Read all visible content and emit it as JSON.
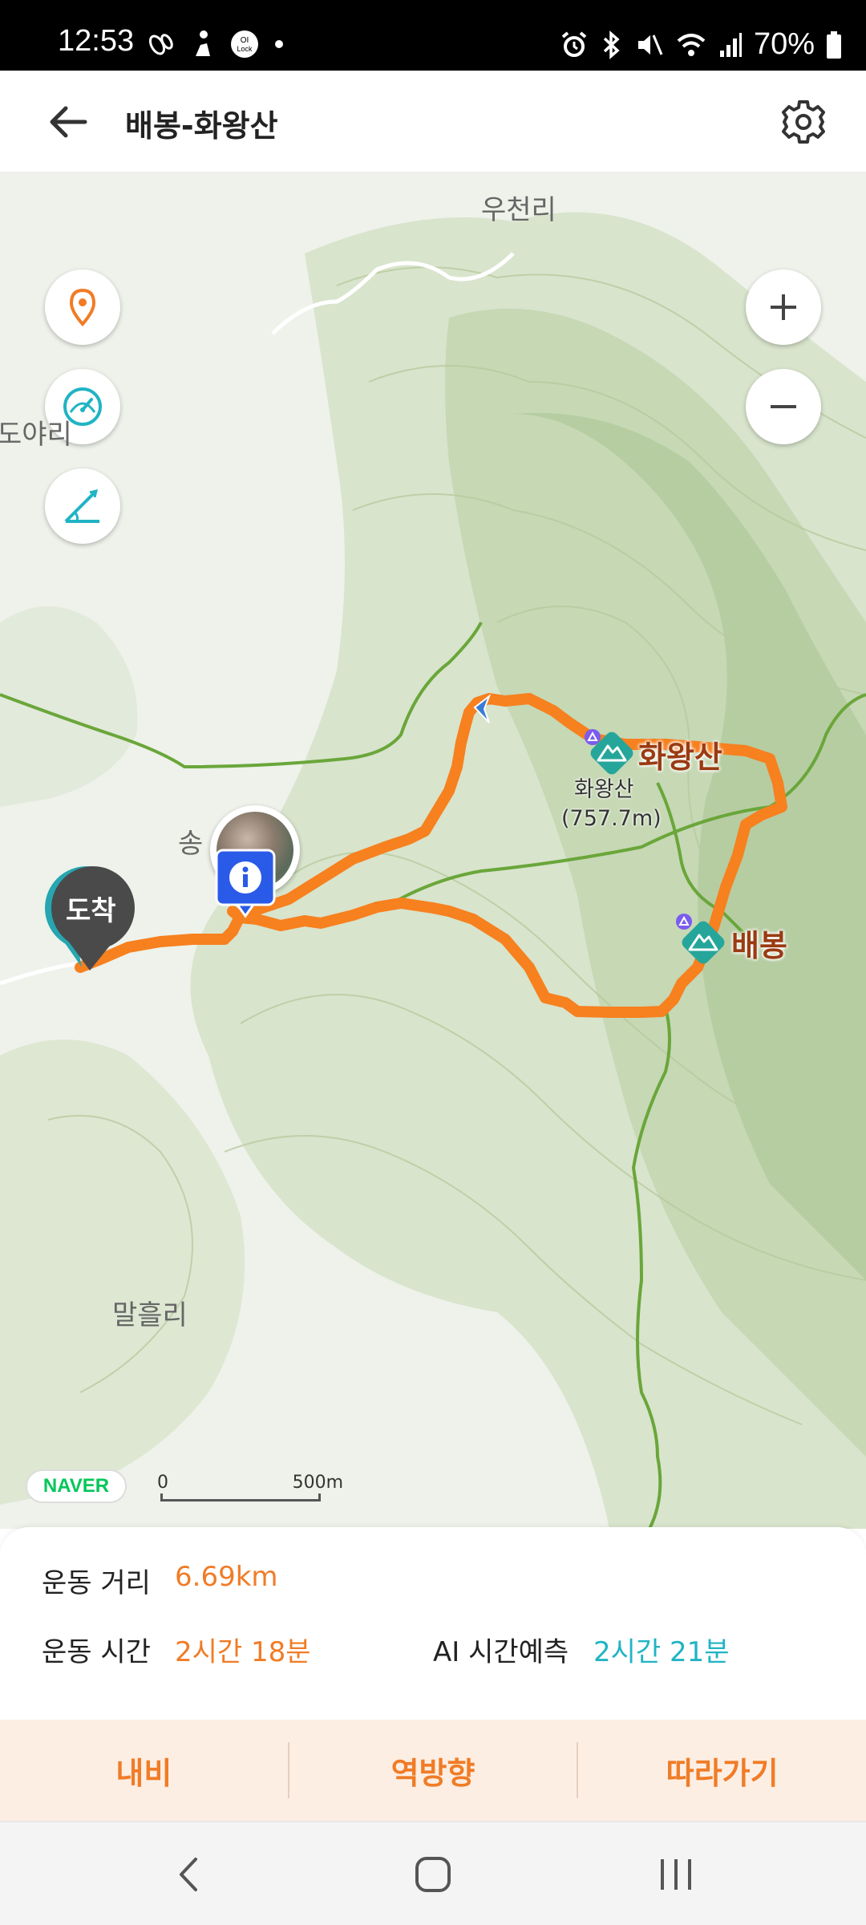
{
  "status_bar": {
    "time": "12:53",
    "battery": "70%",
    "left_icons": [
      "shoe-print-icon",
      "walker-icon",
      "lock-app-icon",
      "dot-icon"
    ],
    "right_icons": [
      "alarm-icon",
      "bluetooth-icon",
      "mute-icon",
      "wifi-icon",
      "signal-icon",
      "battery-icon"
    ]
  },
  "app_bar": {
    "title": "배봉-화왕산",
    "back_icon": "arrow-left-icon",
    "settings_icon": "gear-icon"
  },
  "map": {
    "places": {
      "uncheon": "우천리",
      "doyari": "도야리",
      "malheulri": "말흘리",
      "song": "송"
    },
    "peaks": {
      "hwawangsan": "화왕산",
      "hwawangsan_sub_name": "화왕산",
      "hwawangsan_sub_elev": "(757.7m)",
      "baebong": "배봉"
    },
    "arrival_marker": "도착",
    "provider": "NAVER",
    "scale_zero": "0",
    "scale_max": "500m",
    "colors": {
      "route": "#f7801f",
      "trail": "#6aa63a",
      "peak_icon": "#26a69a",
      "info_marker": "#2a5ae8"
    }
  },
  "stats": {
    "distance_label": "운동 거리",
    "distance_value": "6.69km",
    "time_label": "운동 시간",
    "time_value": "2시간 18분",
    "ai_label": "AI 시간예측",
    "ai_value": "2시간 21분"
  },
  "actions": {
    "navi": "내비",
    "reverse": "역방향",
    "follow": "따라가기"
  }
}
